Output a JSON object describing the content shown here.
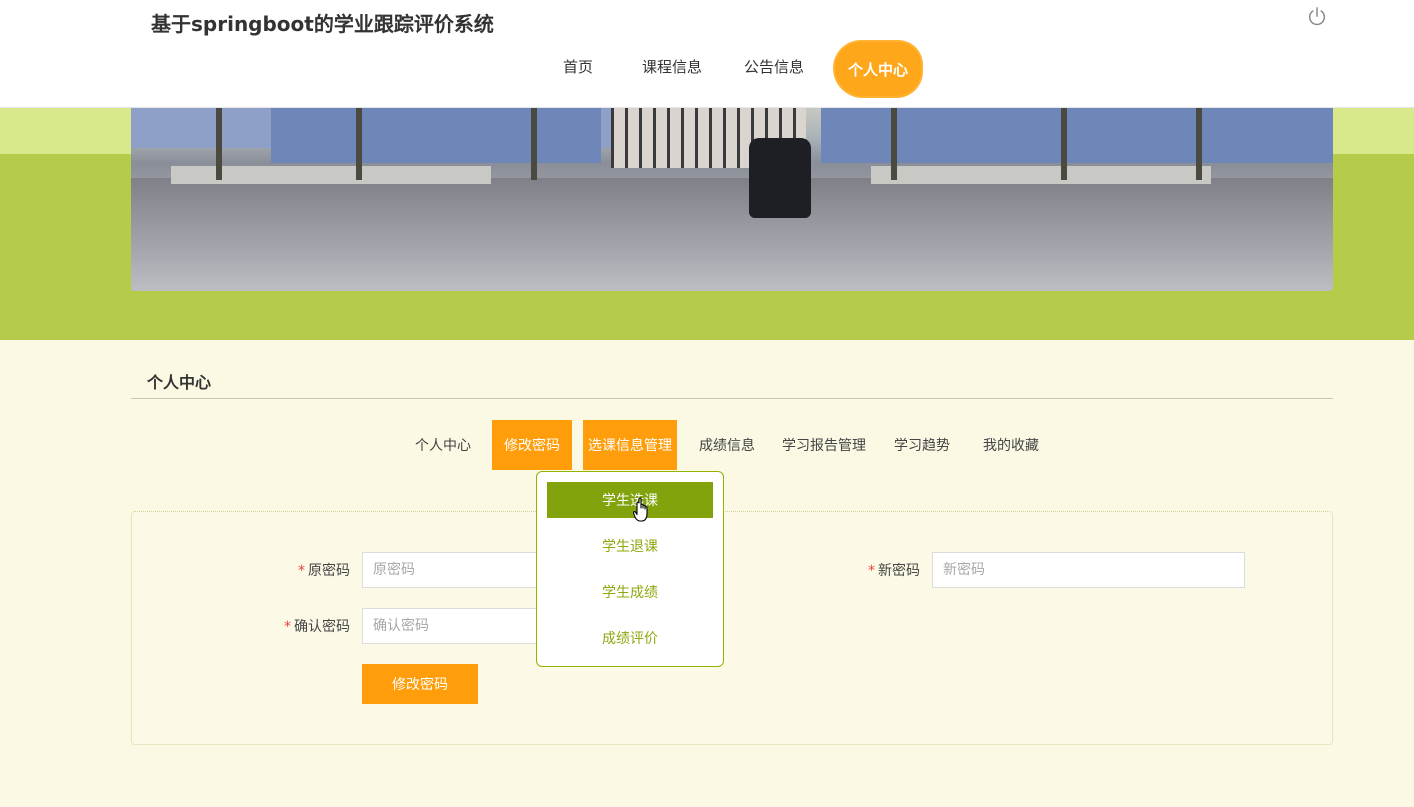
{
  "header": {
    "title": "基于springboot的学业跟踪评价系统",
    "nav": [
      {
        "label": "首页"
      },
      {
        "label": "课程信息"
      },
      {
        "label": "公告信息"
      },
      {
        "label": "个人中心"
      }
    ],
    "power_icon": "power-icon"
  },
  "main": {
    "section_title": "个人中心",
    "tabs": [
      {
        "label": "个人中心",
        "active": false
      },
      {
        "label": "修改密码",
        "active": true
      },
      {
        "label": "选课信息管理",
        "active": true
      },
      {
        "label": "成绩信息",
        "active": false
      },
      {
        "label": "学习报告管理",
        "active": false
      },
      {
        "label": "学习趋势",
        "active": false
      },
      {
        "label": "我的收藏",
        "active": false
      }
    ],
    "dropdown": [
      {
        "label": "学生选课"
      },
      {
        "label": "学生退课"
      },
      {
        "label": "学生成绩"
      },
      {
        "label": "成绩评价"
      }
    ]
  },
  "form": {
    "required_mark": "*",
    "old_password_label": "原密码",
    "old_password_placeholder": "原密码",
    "new_password_label": "新密码",
    "new_password_placeholder": "新密码",
    "confirm_password_label": "确认密码",
    "confirm_password_placeholder": "确认密码",
    "submit_label": "修改密码"
  },
  "colors": {
    "accent_orange": "#ff9d0a",
    "dropdown_green": "#82a30c",
    "banner_green": "#b5cc4a",
    "page_bg": "#fbf8e4"
  }
}
